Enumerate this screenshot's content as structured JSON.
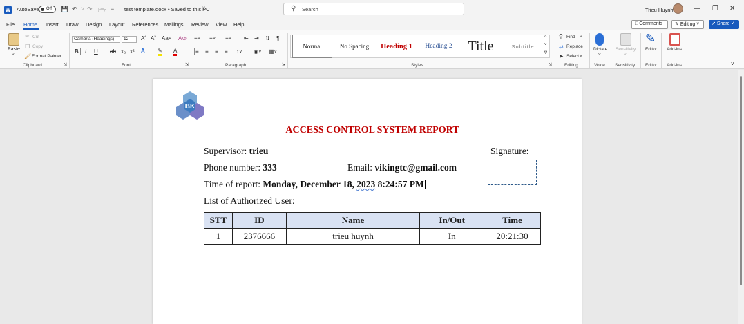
{
  "titlebar": {
    "app_logo": "W",
    "autosave_label": "AutoSave",
    "autosave_state": "Off",
    "doc_title": "test template.docx  •  Saved to this PC",
    "search_placeholder": "Search",
    "user_name": "Trieu Huynh"
  },
  "menu": {
    "tabs": [
      "File",
      "Home",
      "Insert",
      "Draw",
      "Design",
      "Layout",
      "References",
      "Mailings",
      "Review",
      "View",
      "Help"
    ],
    "active_tab": "Home",
    "comments_label": "Comments",
    "editing_label": "Editing",
    "share_label": "Share"
  },
  "ribbon": {
    "clipboard": {
      "paste": "Paste",
      "cut": "Cut",
      "copy": "Copy",
      "format_painter": "Format Painter",
      "label": "Clipboard"
    },
    "font": {
      "family": "Cambria (Headings)",
      "size": "12",
      "label": "Font"
    },
    "paragraph": {
      "label": "Paragraph"
    },
    "styles": {
      "items": [
        "Normal",
        "No Spacing",
        "Heading 1",
        "Heading 2",
        "Title",
        "Subtitle"
      ],
      "label": "Styles"
    },
    "editing": {
      "find": "Find",
      "replace": "Replace",
      "select": "Select",
      "label": "Editing"
    },
    "voice": {
      "dictate": "Dictate",
      "label": "Voice"
    },
    "sensitivity": {
      "button": "Sensitivity",
      "label": "Sensitivity"
    },
    "editor": {
      "button": "Editor",
      "label": "Editor"
    },
    "addins": {
      "button": "Add-ins",
      "label": "Add-ins"
    }
  },
  "document": {
    "logo_text": "BK",
    "title": "ACCESS CONTROL SYSTEM REPORT",
    "supervisor_label": "Supervisor: ",
    "supervisor_value": "trieu",
    "signature_label": "Signature:",
    "phone_label": "Phone number: ",
    "phone_value": "333",
    "email_label": "Email: ",
    "email_value": "vikingtc@gmail.com",
    "time_label": "Time of report: ",
    "time_value_pre": "Monday, December 18, ",
    "time_value_year": "2023",
    "time_value_post": " 8:24:57 PM",
    "list_label": "List of Authorized User:",
    "table": {
      "headers": [
        "STT",
        "ID",
        "Name",
        "In/Out",
        "Time"
      ],
      "rows": [
        [
          "1",
          "2376666",
          "trieu huynh",
          "In",
          "20:21:30"
        ]
      ]
    }
  },
  "colors": {
    "accent": "#185abd",
    "heading_red": "#c00000",
    "table_header_bg": "#d9e2f3"
  }
}
